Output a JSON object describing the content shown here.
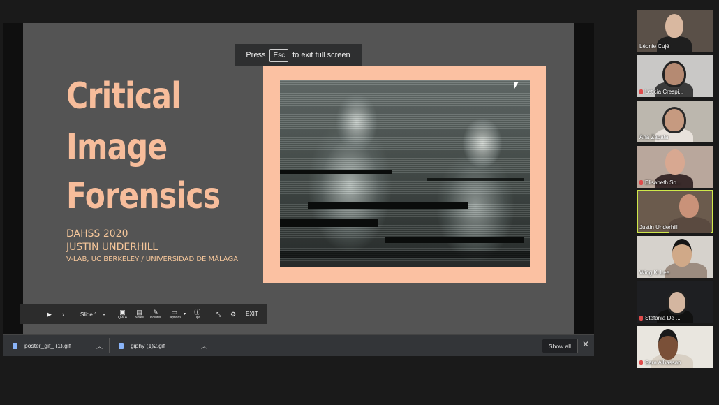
{
  "slide": {
    "title_lines": [
      "Critical",
      "Image",
      "Forensics"
    ],
    "subtitle_lines": [
      "DAHSS 2020",
      "JUSTIN UNDERHILL",
      "V-LAB, UC BERKELEY / UNIVERSIDAD DE MÁLAGA"
    ],
    "colors": {
      "title": "#f7bd9b",
      "background": "#545454",
      "frame": "#fbc1a2"
    }
  },
  "esc_banner": {
    "prefix": "Press",
    "key": "Esc",
    "suffix": "to exit full screen"
  },
  "presenter_toolbar": {
    "slide_selector": "Slide 1",
    "tools": [
      "Q & A",
      "Notes",
      "Pointer",
      "Captions",
      "Tips"
    ],
    "exit_label": "EXIT"
  },
  "downloads": {
    "items": [
      "poster_gif_ (1).gif",
      "giphy (1)2.gif"
    ],
    "show_all_label": "Show all"
  },
  "participants": [
    {
      "name": "Léonie Cujé",
      "muted": false,
      "active": false
    },
    {
      "name": "Leticia Crespi...",
      "muted": true,
      "active": false
    },
    {
      "name": "Ana Zapata",
      "muted": false,
      "active": false
    },
    {
      "name": "Elisabeth So...",
      "muted": true,
      "active": false
    },
    {
      "name": "Justin Underhill",
      "muted": false,
      "active": true
    },
    {
      "name": "Wing Ki Lee",
      "muted": false,
      "active": false
    },
    {
      "name": "Stefania De ...",
      "muted": true,
      "active": false
    },
    {
      "name": "Sara Alhassan",
      "muted": true,
      "active": false
    }
  ]
}
